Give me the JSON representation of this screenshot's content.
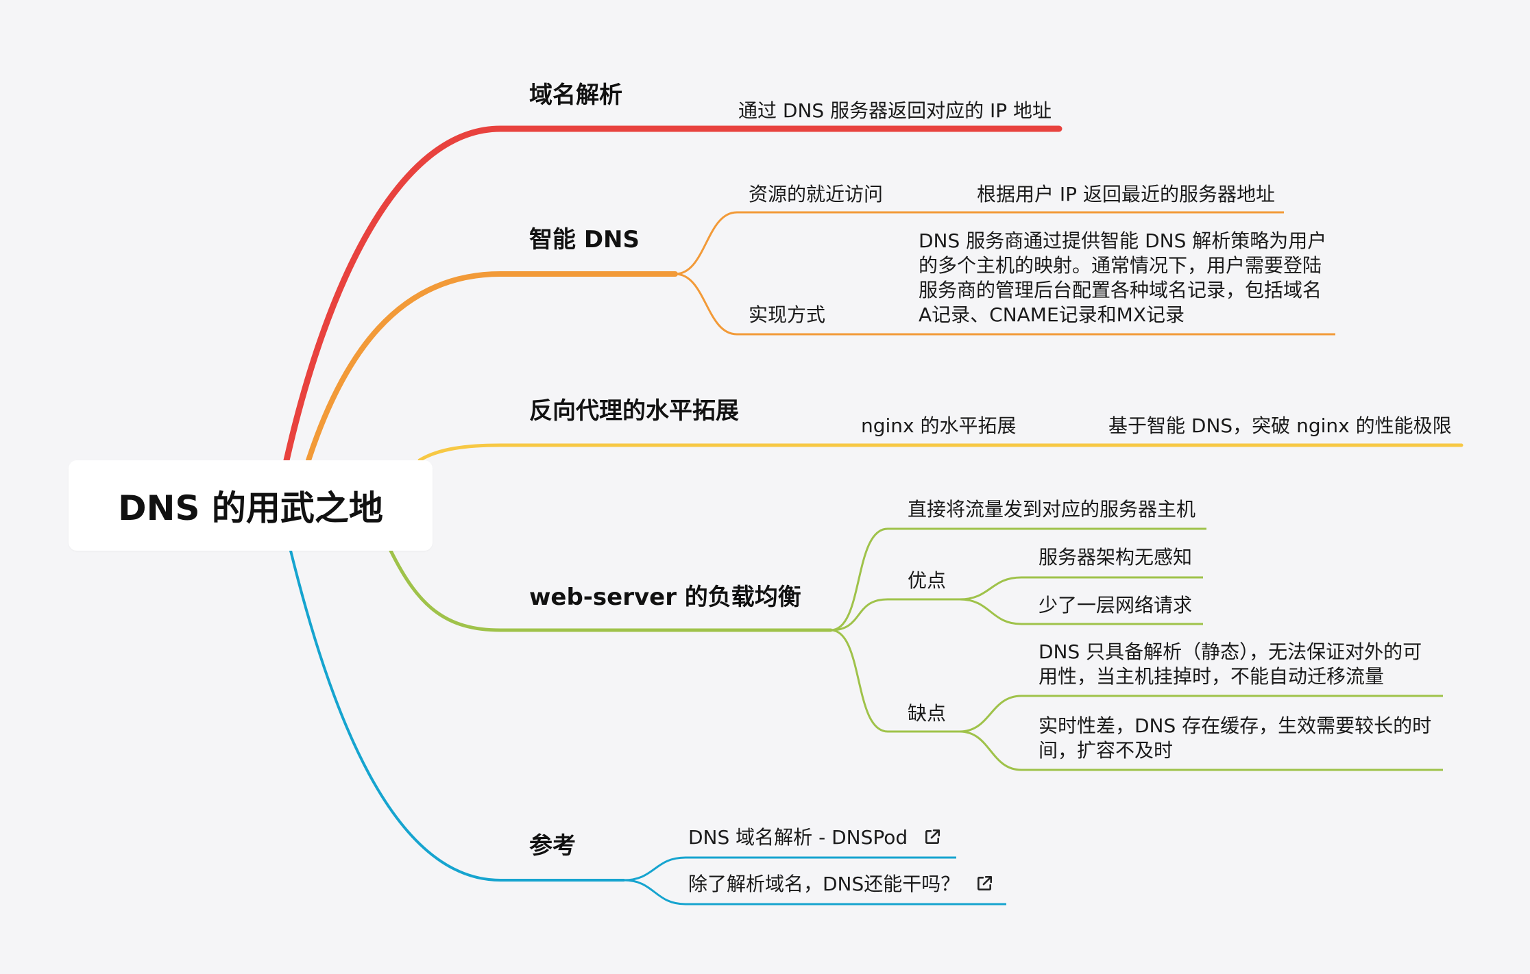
{
  "root": {
    "label": "DNS 的用武之地"
  },
  "branches": {
    "domain_resolution": {
      "color": "#e8423e",
      "label": "域名解析",
      "children": [
        {
          "label": "通过 DNS 服务器返回对应的 IP 地址"
        }
      ]
    },
    "smart_dns": {
      "color": "#f29a38",
      "label": "智能 DNS",
      "children": [
        {
          "label": "资源的就近访问",
          "detail": "根据用户 IP 返回最近的服务器地址"
        },
        {
          "label": "实现方式",
          "detail_lines": [
            "DNS 服务商通过提供智能 DNS 解析策略为用户",
            "的多个主机的映射。通常情况下，用户需要登陆",
            "服务商的管理后台配置各种域名记录，包括域名",
            "A记录、CNAME记录和MX记录"
          ]
        }
      ]
    },
    "reverse_proxy": {
      "color": "#f7c844",
      "label": "反向代理的水平拓展",
      "children": [
        {
          "label": "nginx 的水平拓展",
          "detail": "基于智能 DNS，突破 nginx 的性能极限"
        }
      ]
    },
    "load_balancing": {
      "color": "#9fc24a",
      "label": "web-server 的负载均衡",
      "children": [
        {
          "label": "直接将流量发到对应的服务器主机"
        },
        {
          "label": "优点",
          "items": [
            "服务器架构无感知",
            "少了一层网络请求"
          ]
        },
        {
          "label": "缺点",
          "items": [
            [
              "DNS 只具备解析（静态），无法保证对外的可",
              "用性，当主机挂掉时，不能自动迁移流量"
            ],
            [
              "实时性差，DNS 存在缓存，生效需要较长的时",
              "间，扩容不及时"
            ]
          ]
        }
      ]
    },
    "references": {
      "color": "#16a4cf",
      "label": "参考",
      "links": [
        {
          "label": "DNS 域名解析 - DNSPod",
          "icon": "external-link-icon"
        },
        {
          "label": "除了解析域名，DNS还能干吗？",
          "icon": "external-link-icon"
        }
      ]
    }
  }
}
